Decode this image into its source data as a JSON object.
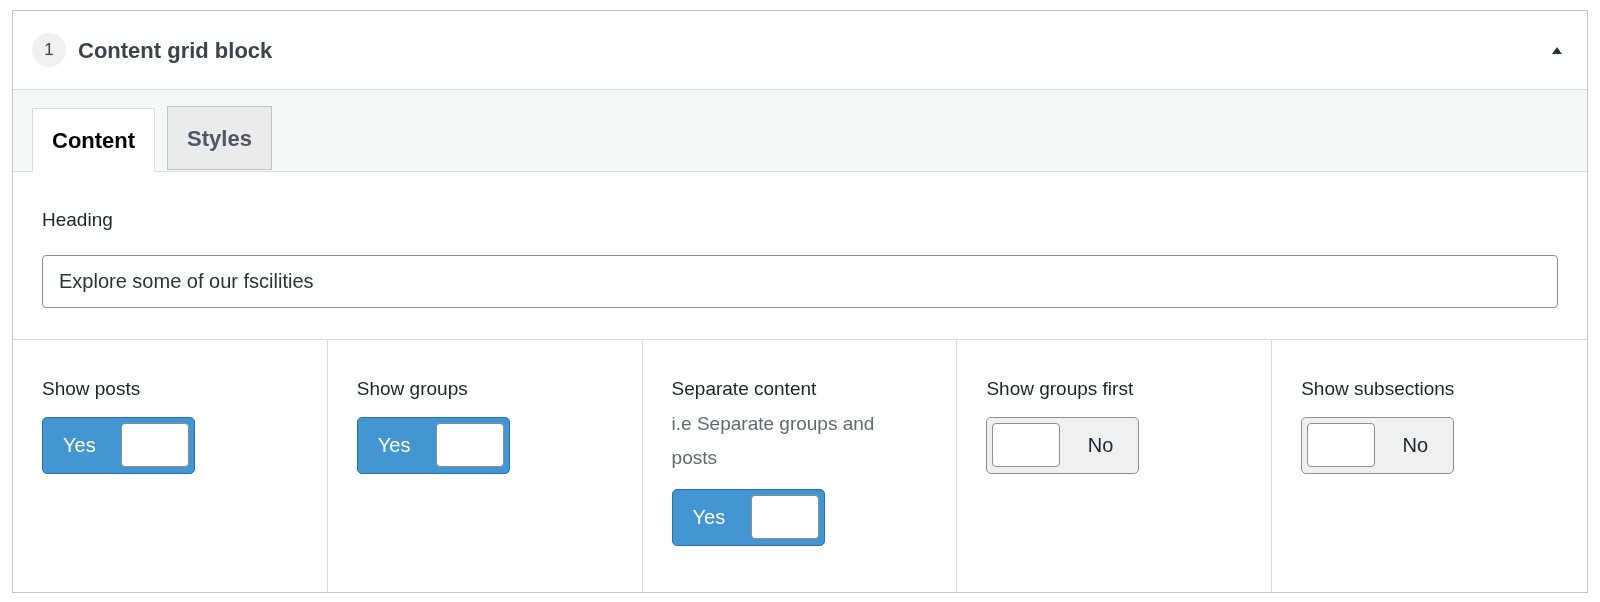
{
  "block": {
    "number": "1",
    "title": "Content grid block",
    "expanded": true
  },
  "tabs": [
    {
      "label": "Content",
      "selected": true
    },
    {
      "label": "Styles",
      "selected": false
    }
  ],
  "heading_field": {
    "label": "Heading",
    "value": "Explore some of our fscilities"
  },
  "toggles": [
    {
      "label": "Show posts",
      "on": true,
      "text": "Yes"
    },
    {
      "label": "Show groups",
      "on": true,
      "text": "Yes"
    },
    {
      "label": "Separate content",
      "description": "i.e Separate groups and posts",
      "on": true,
      "text": "Yes"
    },
    {
      "label": "Show groups first",
      "on": false,
      "text": "No"
    },
    {
      "label": "Show subsections",
      "on": false,
      "text": "No"
    }
  ]
}
